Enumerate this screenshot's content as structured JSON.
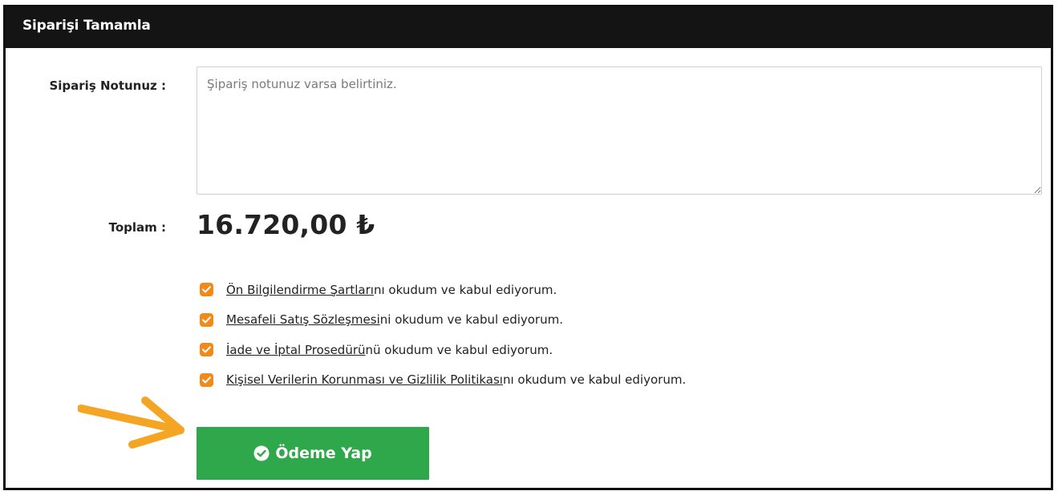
{
  "header": {
    "title": "Siparişi Tamamla"
  },
  "note": {
    "label": "Sipariş Notunuz :",
    "placeholder": "Şipariş notunuz varsa belirtiniz.",
    "value": ""
  },
  "total": {
    "label": "Toplam :",
    "amount": "16.720,00 ₺"
  },
  "terms": [
    {
      "link": "Ön Bilgilendirme Şartları",
      "suffix": "nı okudum ve kabul ediyorum.",
      "checked": true
    },
    {
      "link": "Mesafeli Satış Sözleşmesi",
      "suffix": "ni okudum ve kabul ediyorum.",
      "checked": true
    },
    {
      "link": "İade ve İptal Prosedürü",
      "suffix": "nü okudum ve kabul ediyorum.",
      "checked": true
    },
    {
      "link": "Kişisel Verilerin Korunması ve Gizlilik Politikası",
      "suffix": "nı okudum ve kabul ediyorum.",
      "checked": true
    }
  ],
  "pay_button": {
    "label": "Ödeme Yap",
    "icon": "check-circle-icon",
    "color": "#2ea84a"
  },
  "colors": {
    "header_bg": "#141414",
    "checkbox": "#f28a1a",
    "arrow": "#f5a524"
  },
  "annotation": {
    "icon": "arrow-pointer-icon"
  }
}
